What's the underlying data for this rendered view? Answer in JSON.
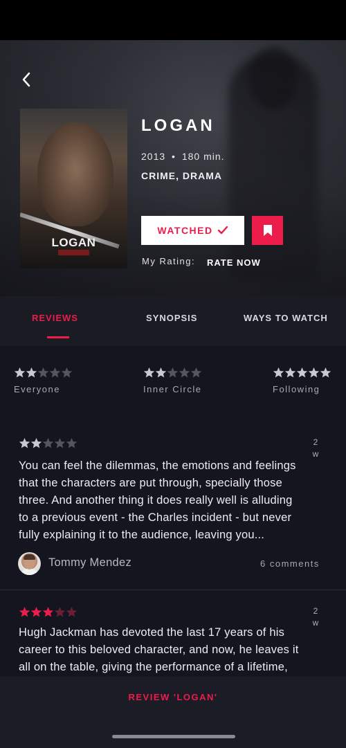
{
  "movie": {
    "title": "LOGAN",
    "year": "2013",
    "separator": "•",
    "runtime": "180 min.",
    "genres": "CRIME, DRAMA",
    "poster_title": "LOGAN"
  },
  "actions": {
    "watched_label": "WATCHED",
    "my_rating_label": "My Rating:",
    "rate_now_label": "RATE NOW"
  },
  "tabs": [
    {
      "label": "REVIEWS",
      "active": true
    },
    {
      "label": "SYNOPSIS",
      "active": false
    },
    {
      "label": "WAYS TO WATCH",
      "active": false
    }
  ],
  "rating_summary": [
    {
      "label": "Everyone",
      "stars": 2
    },
    {
      "label": "Inner Circle",
      "stars": 2
    },
    {
      "label": "Following",
      "stars": 5
    }
  ],
  "reviews": [
    {
      "stars": 2,
      "age_value": "2",
      "age_unit": "w",
      "lines": [
        "You can feel the dilemmas, the emotions and feelings",
        "that the characters are put through, specially those",
        "three. And another thing it does really well is alluding",
        "to a previous event - the Charles incident - but never",
        "fully explaining it to the audience, leaving you..."
      ],
      "author": "Tommy Mendez",
      "comments": "6 comments"
    },
    {
      "stars": 3,
      "age_value": "2",
      "age_unit": "w",
      "lines": [
        "Hugh Jackman has devoted the last 17 years of his",
        "career to this beloved character, and now, he leaves it",
        "all on the table, giving the performance of a lifetime,"
      ]
    }
  ],
  "bottom": {
    "cta_label": "REVIEW 'LOGAN'"
  },
  "colors": {
    "accent": "#ec1c4b",
    "star_empty": "#55555f",
    "star_grey": "#c9c9d1",
    "background": "#15151f"
  },
  "icons": {
    "back": "chevron-left-icon",
    "check": "check-icon",
    "bookmark": "bookmark-icon",
    "star": "star-icon"
  }
}
